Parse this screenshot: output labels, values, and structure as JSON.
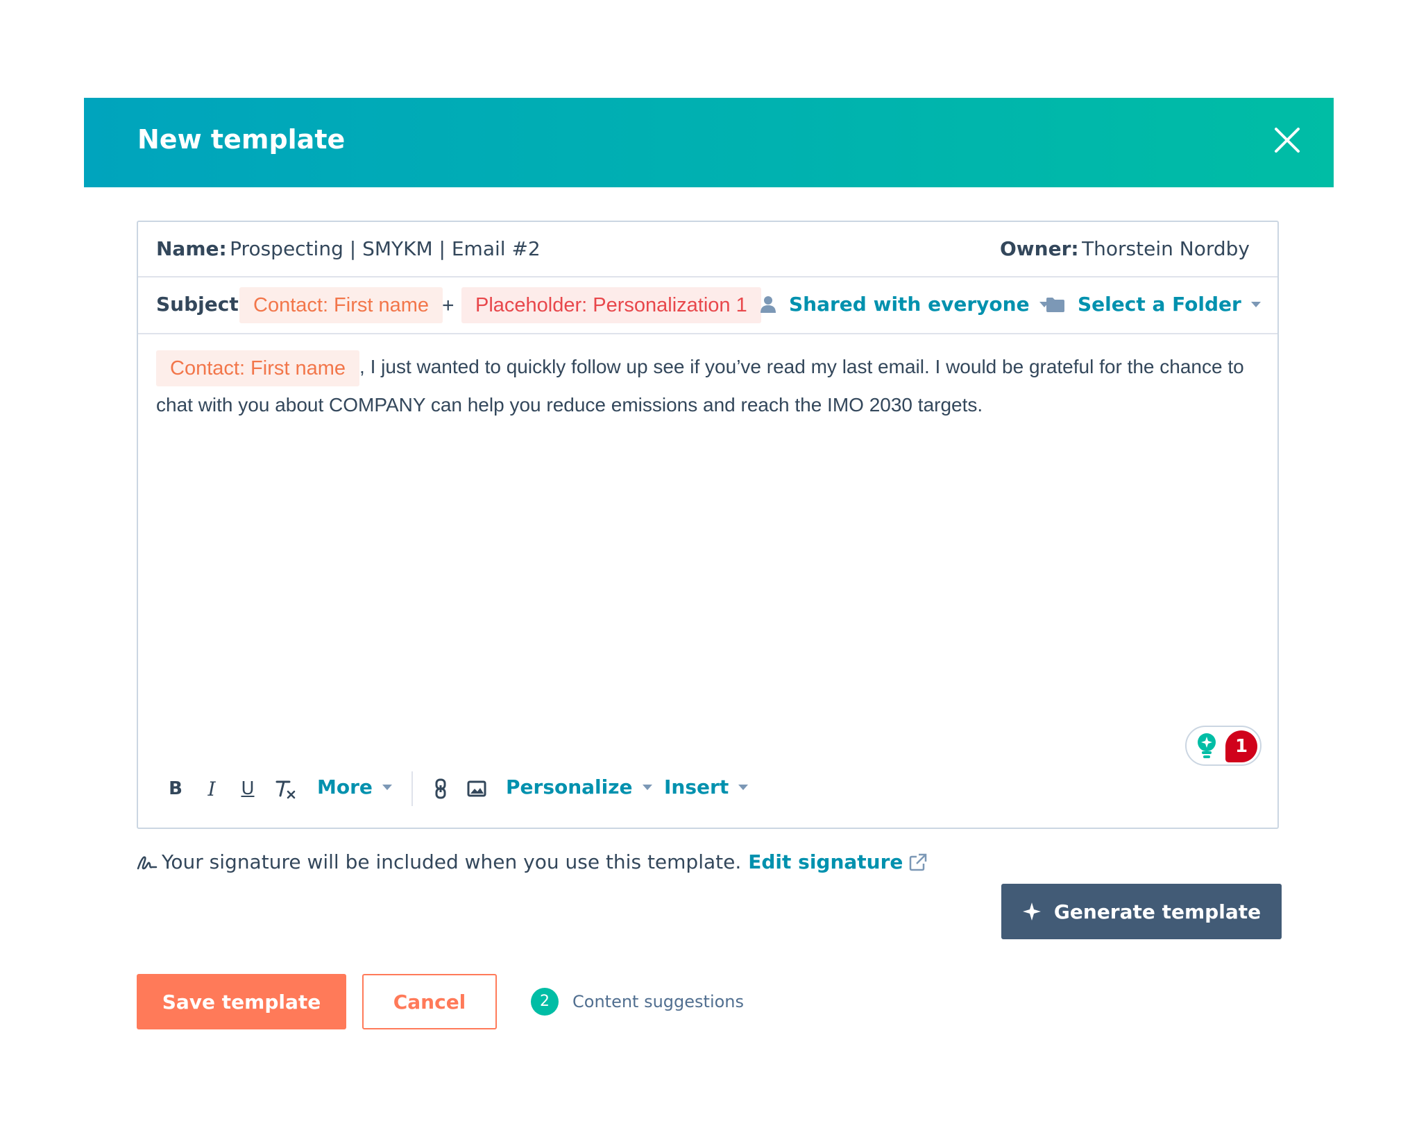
{
  "modal": {
    "title": "New template"
  },
  "fields": {
    "name_label": "Name:",
    "name_value": "Prospecting | SMYKM | Email #2",
    "owner_label": "Owner:",
    "owner_value": "Thorstein Nordby",
    "subject_label": "Subject:",
    "subject_tokens": [
      "Contact: First name",
      "Placeholder: Personalization 1"
    ],
    "subject_plus": "+",
    "sharing_label": "Shared with everyone",
    "folder_label": "Select a Folder"
  },
  "body": {
    "token": "Contact: First name",
    "text": ", I just wanted to quickly follow up see if you’ve read my last email. I would be grateful for the chance to chat with you about COMPANY can help you reduce emissions and reach the IMO 2030 targets."
  },
  "suggestion_badge": {
    "count": "1"
  },
  "toolbar": {
    "bold": "B",
    "italic": "I",
    "underline": "U",
    "more_label": "More",
    "personalize_label": "Personalize",
    "insert_label": "Insert"
  },
  "signature": {
    "note": "Your signature will be included when you use this template.",
    "edit_label": "Edit signature"
  },
  "actions": {
    "generate_label": "Generate template",
    "save_label": "Save template",
    "cancel_label": "Cancel"
  },
  "content_suggestions": {
    "count": "2",
    "label": "Content suggestions"
  },
  "colors": {
    "header_gradient_start": "#00a4bd",
    "header_gradient_end": "#00bda5",
    "link": "#0091ae",
    "primary": "#ff7a59",
    "dark_button": "#425b76",
    "alert": "#d0021b"
  }
}
